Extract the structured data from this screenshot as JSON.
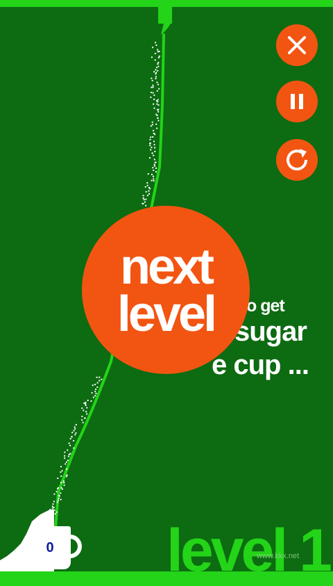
{
  "game": {
    "title": "level 1",
    "next_level": {
      "line1": "next",
      "line2": "level"
    },
    "hint": {
      "line1": "o get",
      "line2": "sugar",
      "line3": "e cup ..."
    },
    "cup": {
      "count": "0"
    },
    "watermark": "www.kkx.net"
  },
  "controls": [
    {
      "id": "close",
      "icon": "close-icon"
    },
    {
      "id": "pause",
      "icon": "pause-icon"
    },
    {
      "id": "restart",
      "icon": "restart-icon"
    }
  ],
  "colors": {
    "background": "#0d6b12",
    "accent_green": "#23d418",
    "button_orange": "#f25511",
    "sugar": "#ffffff",
    "cup_count": "#101a9c"
  }
}
